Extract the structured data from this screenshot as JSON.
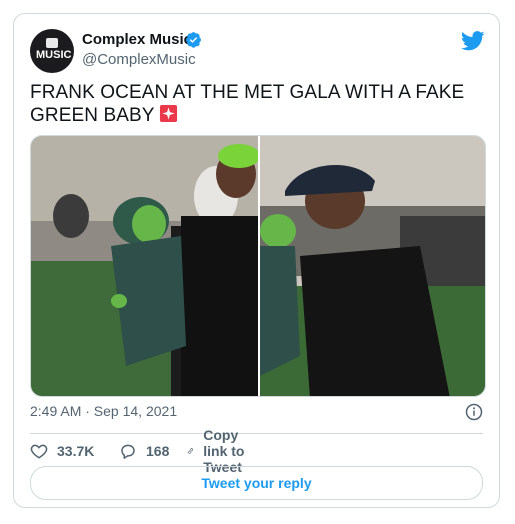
{
  "tweet": {
    "author": {
      "name": "Complex Music",
      "handle": "@ComplexMusic",
      "avatar_text": "MUSIC",
      "verified": true
    },
    "text": "FRANK OCEAN AT THE MET GALA WITH A FAKE GREEN BABY",
    "emoji": "siren-icon",
    "timestamp": "2:49 AM · Sep 14, 2021",
    "actions": {
      "likes": "33.7K",
      "replies": "168",
      "copy_link": "Copy link to Tweet"
    },
    "reply_button": "Tweet your reply"
  },
  "colors": {
    "accent": "#1d9bf0",
    "muted": "#536471",
    "border": "#cfd9de"
  }
}
